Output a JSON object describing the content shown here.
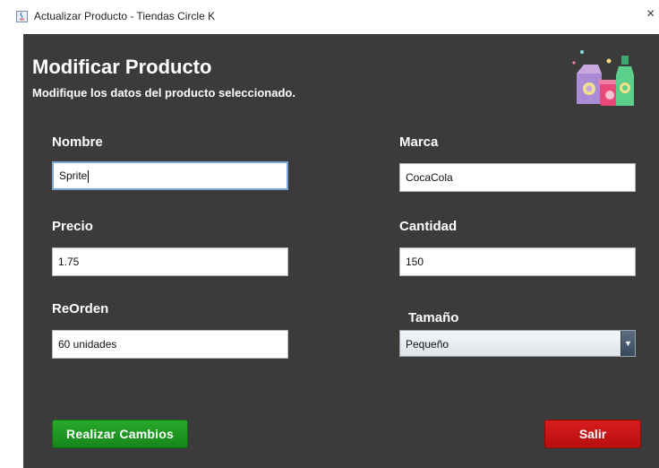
{
  "window": {
    "title": "Actualizar Producto - Tiendas Circle K",
    "close_glyph": "×"
  },
  "header": {
    "title": "Modificar Producto",
    "subtitle": "Modifique los datos del producto seleccionado.",
    "logo_icon": "products-icon"
  },
  "form": {
    "nombre": {
      "label": "Nombre",
      "value": "Sprite"
    },
    "marca": {
      "label": "Marca",
      "value": "CocaCola"
    },
    "precio": {
      "label": "Precio",
      "value": "1.75"
    },
    "cantidad": {
      "label": "Cantidad",
      "value": "150"
    },
    "reorden": {
      "label": "ReOrden",
      "value": "60 unidades"
    },
    "tamano": {
      "label": "Tamaño",
      "value": "Pequeño"
    }
  },
  "buttons": {
    "submit_label": "Realizar Cambios",
    "exit_label": "Salir"
  },
  "colors": {
    "panel_bg": "#3b3b3b",
    "submit_green": "#1f9a22",
    "exit_red": "#c81414"
  }
}
